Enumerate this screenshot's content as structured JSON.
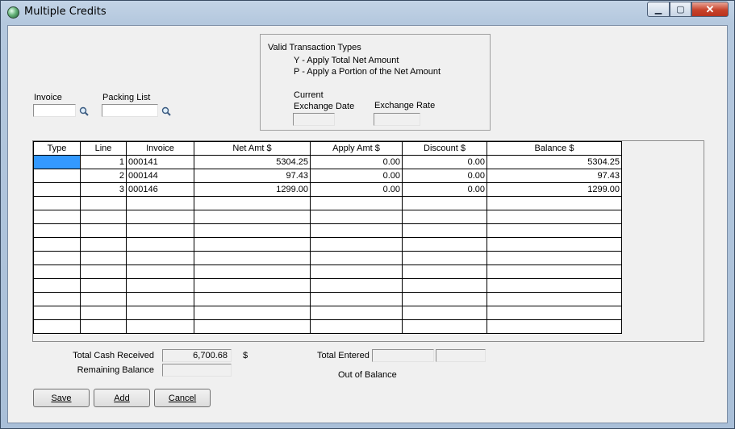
{
  "window": {
    "title": "Multiple Credits",
    "minimize_glyph": "▁",
    "maximize_glyph": "▢",
    "close_glyph": "✕"
  },
  "lookup": {
    "invoice_label": "Invoice",
    "invoice_value": "",
    "packing_list_label": "Packing List",
    "packing_list_value": ""
  },
  "transaction_types": {
    "heading": "Valid Transaction Types",
    "y_line": "Y - Apply Total Net Amount",
    "p_line": "P - Apply a Portion of the Net Amount",
    "current_label": "Current",
    "exchange_date_label": "Exchange Date",
    "exchange_rate_label": "Exchange Rate",
    "exchange_date_value": "",
    "exchange_rate_value": ""
  },
  "grid": {
    "columns": [
      "Type",
      "Line",
      "Invoice",
      "Net Amt $",
      "Apply Amt $",
      "Discount $",
      "Balance $"
    ],
    "rows": [
      [
        "",
        "1",
        "000141",
        "5304.25",
        "0.00",
        "0.00",
        "5304.25"
      ],
      [
        "",
        "2",
        "000144",
        "97.43",
        "0.00",
        "0.00",
        "97.43"
      ],
      [
        "",
        "3",
        "000146",
        "1299.00",
        "0.00",
        "0.00",
        "1299.00"
      ],
      [
        "",
        "",
        "",
        "",
        "",
        "",
        ""
      ],
      [
        "",
        "",
        "",
        "",
        "",
        "",
        ""
      ],
      [
        "",
        "",
        "",
        "",
        "",
        "",
        ""
      ],
      [
        "",
        "",
        "",
        "",
        "",
        "",
        ""
      ],
      [
        "",
        "",
        "",
        "",
        "",
        "",
        ""
      ],
      [
        "",
        "",
        "",
        "",
        "",
        "",
        ""
      ],
      [
        "",
        "",
        "",
        "",
        "",
        "",
        ""
      ],
      [
        "",
        "",
        "",
        "",
        "",
        "",
        ""
      ],
      [
        "",
        "",
        "",
        "",
        "",
        "",
        ""
      ],
      [
        "",
        "",
        "",
        "",
        "",
        "",
        ""
      ]
    ]
  },
  "totals": {
    "total_cash_label": "Total Cash Received",
    "total_cash_value": "6,700.68",
    "currency_symbol": "$",
    "remaining_label": "Remaining Balance",
    "remaining_value": "",
    "total_entered_label": "Total Entered",
    "total_entered_value_1": "",
    "total_entered_value_2": "",
    "out_of_balance_label": "Out of Balance"
  },
  "buttons": {
    "save": "Save",
    "add": "Add",
    "cancel": "Cancel"
  },
  "colors": {
    "selection": "#3399ff",
    "close_button": "#c7432b"
  }
}
